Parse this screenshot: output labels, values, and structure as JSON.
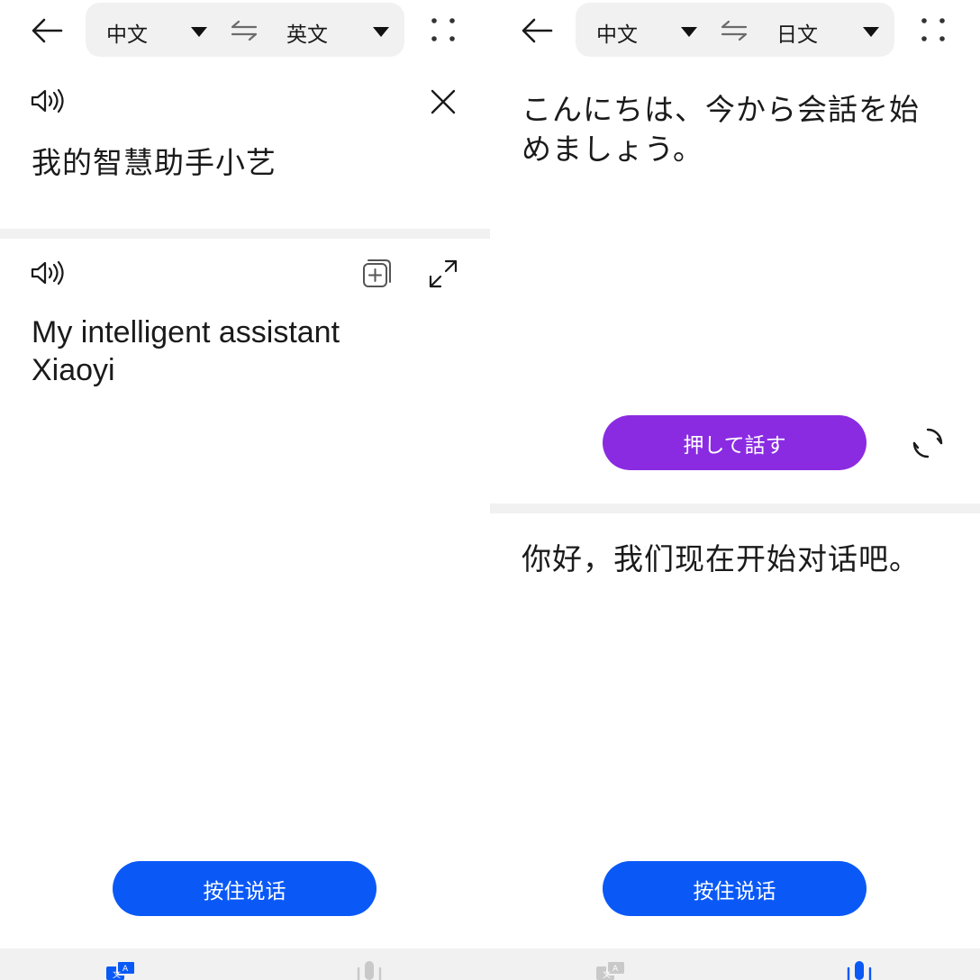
{
  "left": {
    "lang": {
      "source": "中文",
      "target": "英文"
    },
    "source_text": "我的智慧助手小艺",
    "translation_lines": [
      "My intelligent assistant",
      "Xiaoyi"
    ],
    "hold_button": "按住说话"
  },
  "right": {
    "lang": {
      "source": "中文",
      "target": "日文"
    },
    "japanese_text_lines": [
      "こんにちは、今から会話を始",
      "めましょう。"
    ],
    "hold_button_ja": "押して話す",
    "chinese_text": "你好，我们现在开始对话吧。",
    "hold_button": "按住说话"
  },
  "colors": {
    "accent_blue": "#0a59f7",
    "accent_purple": "#8a2be2",
    "surface_gray": "#f1f1f1"
  },
  "icons": [
    "back-arrow-icon",
    "dropdown-triangle-icon",
    "swap-icon",
    "more-grid-icon",
    "speaker-icon",
    "close-icon",
    "add-to-collection-icon",
    "expand-icon",
    "refresh-icon",
    "translate-tab-icon",
    "voice-tab-icon"
  ]
}
